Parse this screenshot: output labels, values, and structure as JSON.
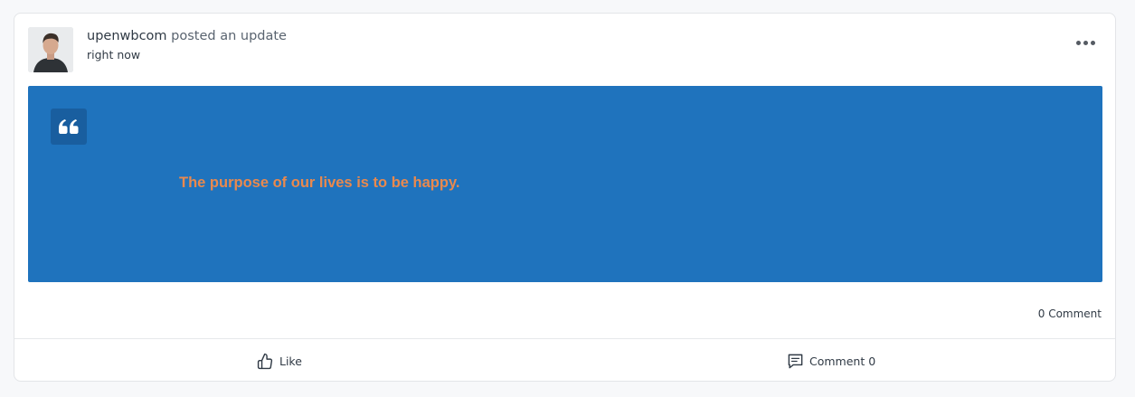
{
  "post": {
    "author": "upenwbcom",
    "action": "posted an update",
    "time": "right now",
    "quote_text": "The purpose of our lives is to be happy.",
    "comment_count_label": "0 Comment"
  },
  "actions": {
    "like_label": "Like",
    "comment_label": "Comment 0"
  },
  "colors": {
    "quote_background": "#1f73bd",
    "quote_icon_background": "#195e9f",
    "quote_text": "#e9894e"
  },
  "icons": {
    "more": "ellipsis-icon",
    "quote": "quote-icon",
    "like": "thumbs-up-icon",
    "comment": "comment-icon"
  }
}
